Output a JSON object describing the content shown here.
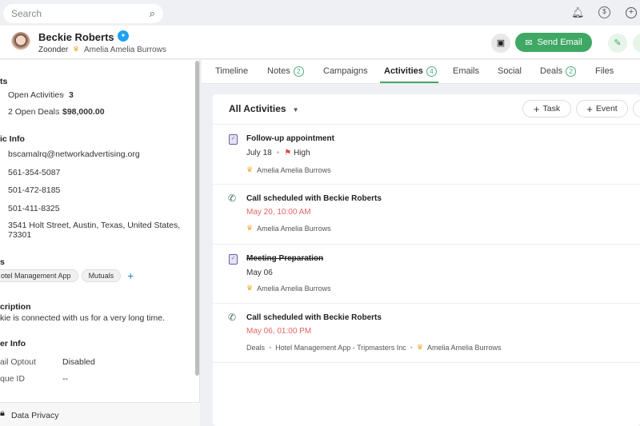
{
  "search": {
    "placeholder": "Search"
  },
  "topbar_icons": [
    "bell-icon",
    "deals-coin-icon",
    "add-circle-icon"
  ],
  "contact": {
    "name": "Beckie Roberts",
    "company": "Zoonder",
    "owner": "Amelia Amelia Burrows",
    "social": "twitter-icon"
  },
  "actions": {
    "send_email": "Send Email",
    "accent": "#3fa865"
  },
  "left": {
    "insights_heading": "ts",
    "open_activities_label": "Open Activities",
    "open_activities_value": "3",
    "open_deals_label": "2 Open Deals",
    "open_deals_value": "$98,000.00",
    "basic_heading": "ic Info",
    "email": "bscamalrq@networkadvertising.org",
    "phone1": "561-354-5087",
    "phone2": "501-472-8185",
    "phone3": "501-411-8325",
    "address_line1": "3541 Holt Street, Austin, Texas, United States,",
    "address_line2": "73301",
    "tags_heading": "s",
    "tags": [
      "otel Management App",
      "Mutuals"
    ],
    "description_heading": "cription",
    "description": "kie is connected with us for a very long time.",
    "other_heading": "er Info",
    "optout_label": "ail Optout",
    "optout_value": "Disabled",
    "uid_label": "que ID",
    "uid_value": "--",
    "privacy": "Data Privacy"
  },
  "tabs": [
    {
      "label": "Timeline"
    },
    {
      "label": "Notes",
      "count": "2"
    },
    {
      "label": "Campaigns"
    },
    {
      "label": "Activities",
      "count": "4",
      "active": true
    },
    {
      "label": "Emails"
    },
    {
      "label": "Social"
    },
    {
      "label": "Deals",
      "count": "2"
    },
    {
      "label": "Files"
    }
  ],
  "activities": {
    "filter": "All Activities",
    "task_btn": "Task",
    "event_btn": "Event",
    "items": [
      {
        "type": "task",
        "title": "Follow-up appointment",
        "date": "July 18",
        "priority": "High",
        "owner": "Amelia Amelia Burrows"
      },
      {
        "type": "call",
        "title": "Call scheduled with Beckie Roberts",
        "date": "May 20, 10:00 AM",
        "owner": "Amelia Amelia Burrows"
      },
      {
        "type": "task",
        "title": "Meeting Preparation",
        "completed": true,
        "date": "May 06",
        "owner": "Amelia Amelia Burrows"
      },
      {
        "type": "call",
        "title": "Call scheduled with Beckie Roberts",
        "date": "May 06, 01:00 PM",
        "module": "Deals",
        "deal": "Hotel Management App - Tripmasters Inc",
        "owner": "Amelia Amelia Burrows"
      }
    ]
  }
}
